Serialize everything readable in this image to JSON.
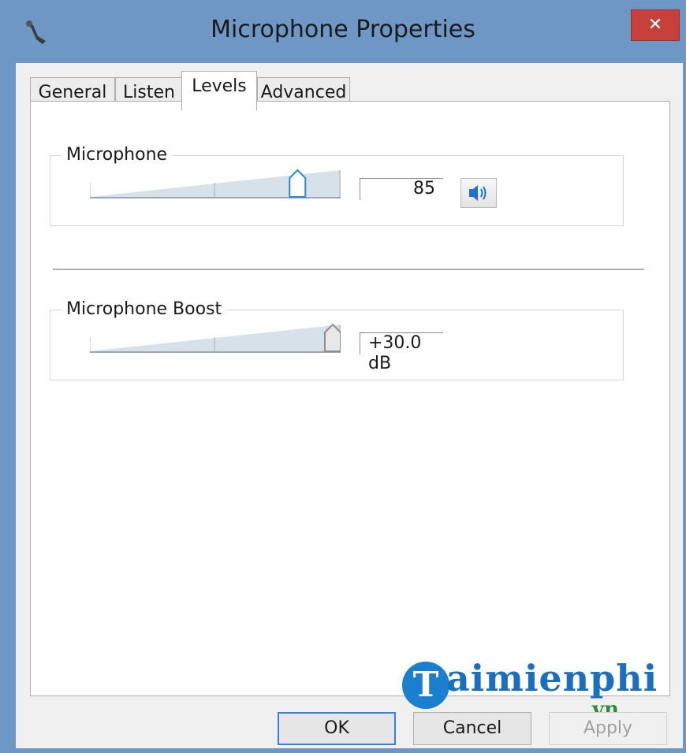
{
  "window": {
    "title": "Microphone Properties",
    "close_glyph": "✕",
    "icon": "microphone-icon"
  },
  "tabs": [
    {
      "label": "General",
      "active": false
    },
    {
      "label": "Listen",
      "active": false
    },
    {
      "label": "Levels",
      "active": true
    },
    {
      "label": "Advanced",
      "active": false
    }
  ],
  "microphone": {
    "group_label": "Microphone",
    "level": 85,
    "level_text": "85",
    "slider_min": 0,
    "slider_max": 100,
    "mute_icon": "speaker-icon"
  },
  "boost": {
    "group_label": "Microphone Boost",
    "value_text": "+30.0 dB",
    "value_db": 30.0,
    "slider_min_db": 0,
    "slider_max_db": 30
  },
  "buttons": {
    "ok": "OK",
    "cancel": "Cancel",
    "apply": "Apply",
    "apply_enabled": false
  },
  "watermark": {
    "logo_letter": "T",
    "brand": "aimienphi",
    "tld": ".vn"
  },
  "colors": {
    "titlebar": "#6f97c6",
    "close": "#c8403a",
    "accent": "#3c7fd4",
    "speaker": "#1e73d2"
  }
}
